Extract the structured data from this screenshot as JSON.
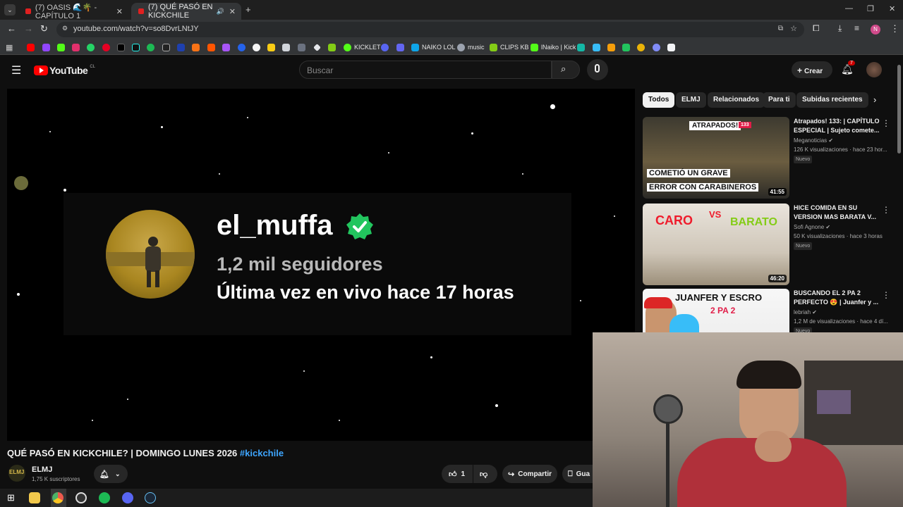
{
  "browser": {
    "tabs": [
      {
        "label": "(7) OASIS 🌊🌴 - CAPÍTULO 1"
      },
      {
        "label": "(7) QUÉ PASÓ EN KICKCHILE"
      }
    ],
    "url": "youtube.com/watch?v=so8DvrLNtJY",
    "bookmarks": [
      "KICKLET",
      "NAIKO LOL",
      "music",
      "CLIPS KB",
      "lNaiko | Kick"
    ],
    "profile_initial": "N"
  },
  "youtube": {
    "logo_text": "YouTube",
    "region": "CL",
    "search_placeholder": "Buscar",
    "create_label": "Crear",
    "notif_count": "7"
  },
  "video": {
    "overlay_name": "el_muffa",
    "overlay_followers": "1,2 mil seguidores",
    "overlay_last_live": "Última vez en vivo hace 17 horas",
    "title": "QUÉ PASÓ EN KICKCHILE? | DOMINGO LUNES 2026",
    "hashtag": "#kickchile",
    "channel_name": "ELMJ",
    "channel_avatar_text": "ELMJ",
    "subscribers": "1,75 K suscriptores",
    "likes": "1",
    "share_label": "Compartir",
    "save_label": "Gua"
  },
  "chips": [
    "Todos",
    "ELMJ",
    "Relacionados",
    "Para ti",
    "Subidas recientes"
  ],
  "recommendations": [
    {
      "title": "Atrapados! 133: | CAPÍTULO ESPECIAL | Sujeto comete...",
      "channel": "Meganoticias",
      "meta": "126 K visualizaciones · hace 23 hor...",
      "badge": "Nuevo",
      "duration": "41:55",
      "thumb_top": "ATRAPADOS!",
      "thumb_episode": "133",
      "thumb_line1": "COMETIÓ UN GRAVE",
      "thumb_line2": "ERROR CON CARABINEROS"
    },
    {
      "title": "HICE COMIDA EN SU VERSION MAS BARATA V...",
      "channel": "Sofi Agnone",
      "meta": "50 K visualizaciones · hace 3 horas",
      "badge": "Nuevo",
      "duration": "46:20",
      "thumb_left": "CARO",
      "thumb_vs": "VS",
      "thumb_right": "BARATO"
    },
    {
      "title": "BUSCANDO EL 2 PA 2 PERFECTO 😍 | Juanfer y ...",
      "channel": "lebriah",
      "meta": "1,2 M de visualizaciones · hace 4 dí...",
      "badge": "Nuevo",
      "thumb_top": "JUANFER Y ESCRO",
      "thumb_sub": "2 PA 2"
    }
  ],
  "colors": {
    "youtube_red": "#ff0000",
    "link_blue": "#3ea6ff",
    "verified_green": "#22c55e"
  }
}
